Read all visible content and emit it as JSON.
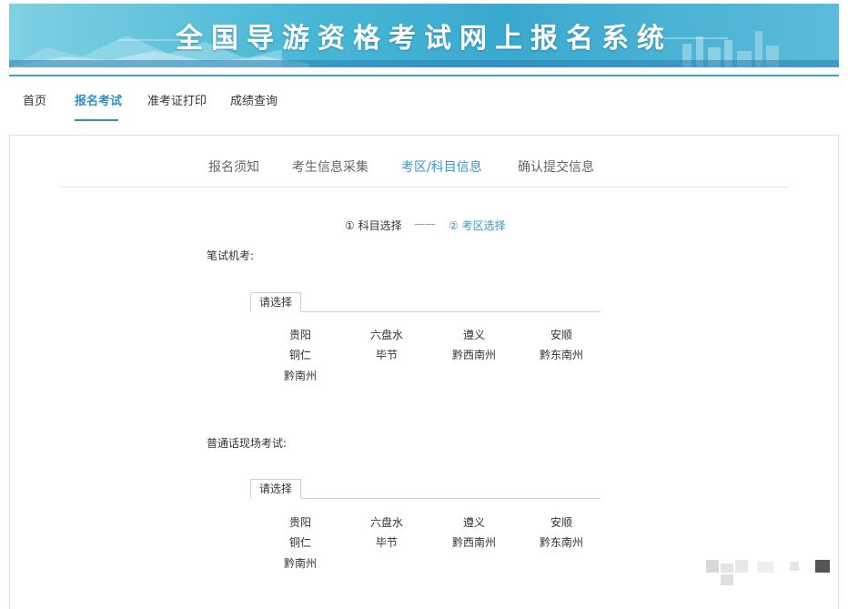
{
  "header": {
    "title": "全国导游资格考试网上报名系统"
  },
  "nav": {
    "items": [
      {
        "label": "首页",
        "active": false
      },
      {
        "label": "报名考试",
        "active": true
      },
      {
        "label": "准考证打印",
        "active": false
      },
      {
        "label": "成绩查询",
        "active": false
      }
    ]
  },
  "steps": {
    "items": [
      {
        "label": "报名须知",
        "active": false
      },
      {
        "label": "考生信息采集",
        "active": false
      },
      {
        "label": "考区/科目信息",
        "active": true
      },
      {
        "label": "确认提交信息",
        "active": false
      }
    ]
  },
  "substeps": {
    "step1": "① 科目选择",
    "separator": "——",
    "step2": "② 考区选择"
  },
  "sections": [
    {
      "label": "笔试机考:",
      "tab": "请选择",
      "regions": [
        "贵阳",
        "六盘水",
        "遵义",
        "安顺",
        "铜仁",
        "毕节",
        "黔西南州",
        "黔东南州",
        "黔南州"
      ]
    },
    {
      "label": "普通话现场考试:",
      "tab": "请选择",
      "regions": [
        "贵阳",
        "六盘水",
        "遵义",
        "安顺",
        "铜仁",
        "毕节",
        "黔西南州",
        "黔东南州",
        "黔南州"
      ]
    }
  ],
  "colors": {
    "accent": "#2f8fc5",
    "step_active": "#3d97c9",
    "banner": "#49b8d6"
  }
}
